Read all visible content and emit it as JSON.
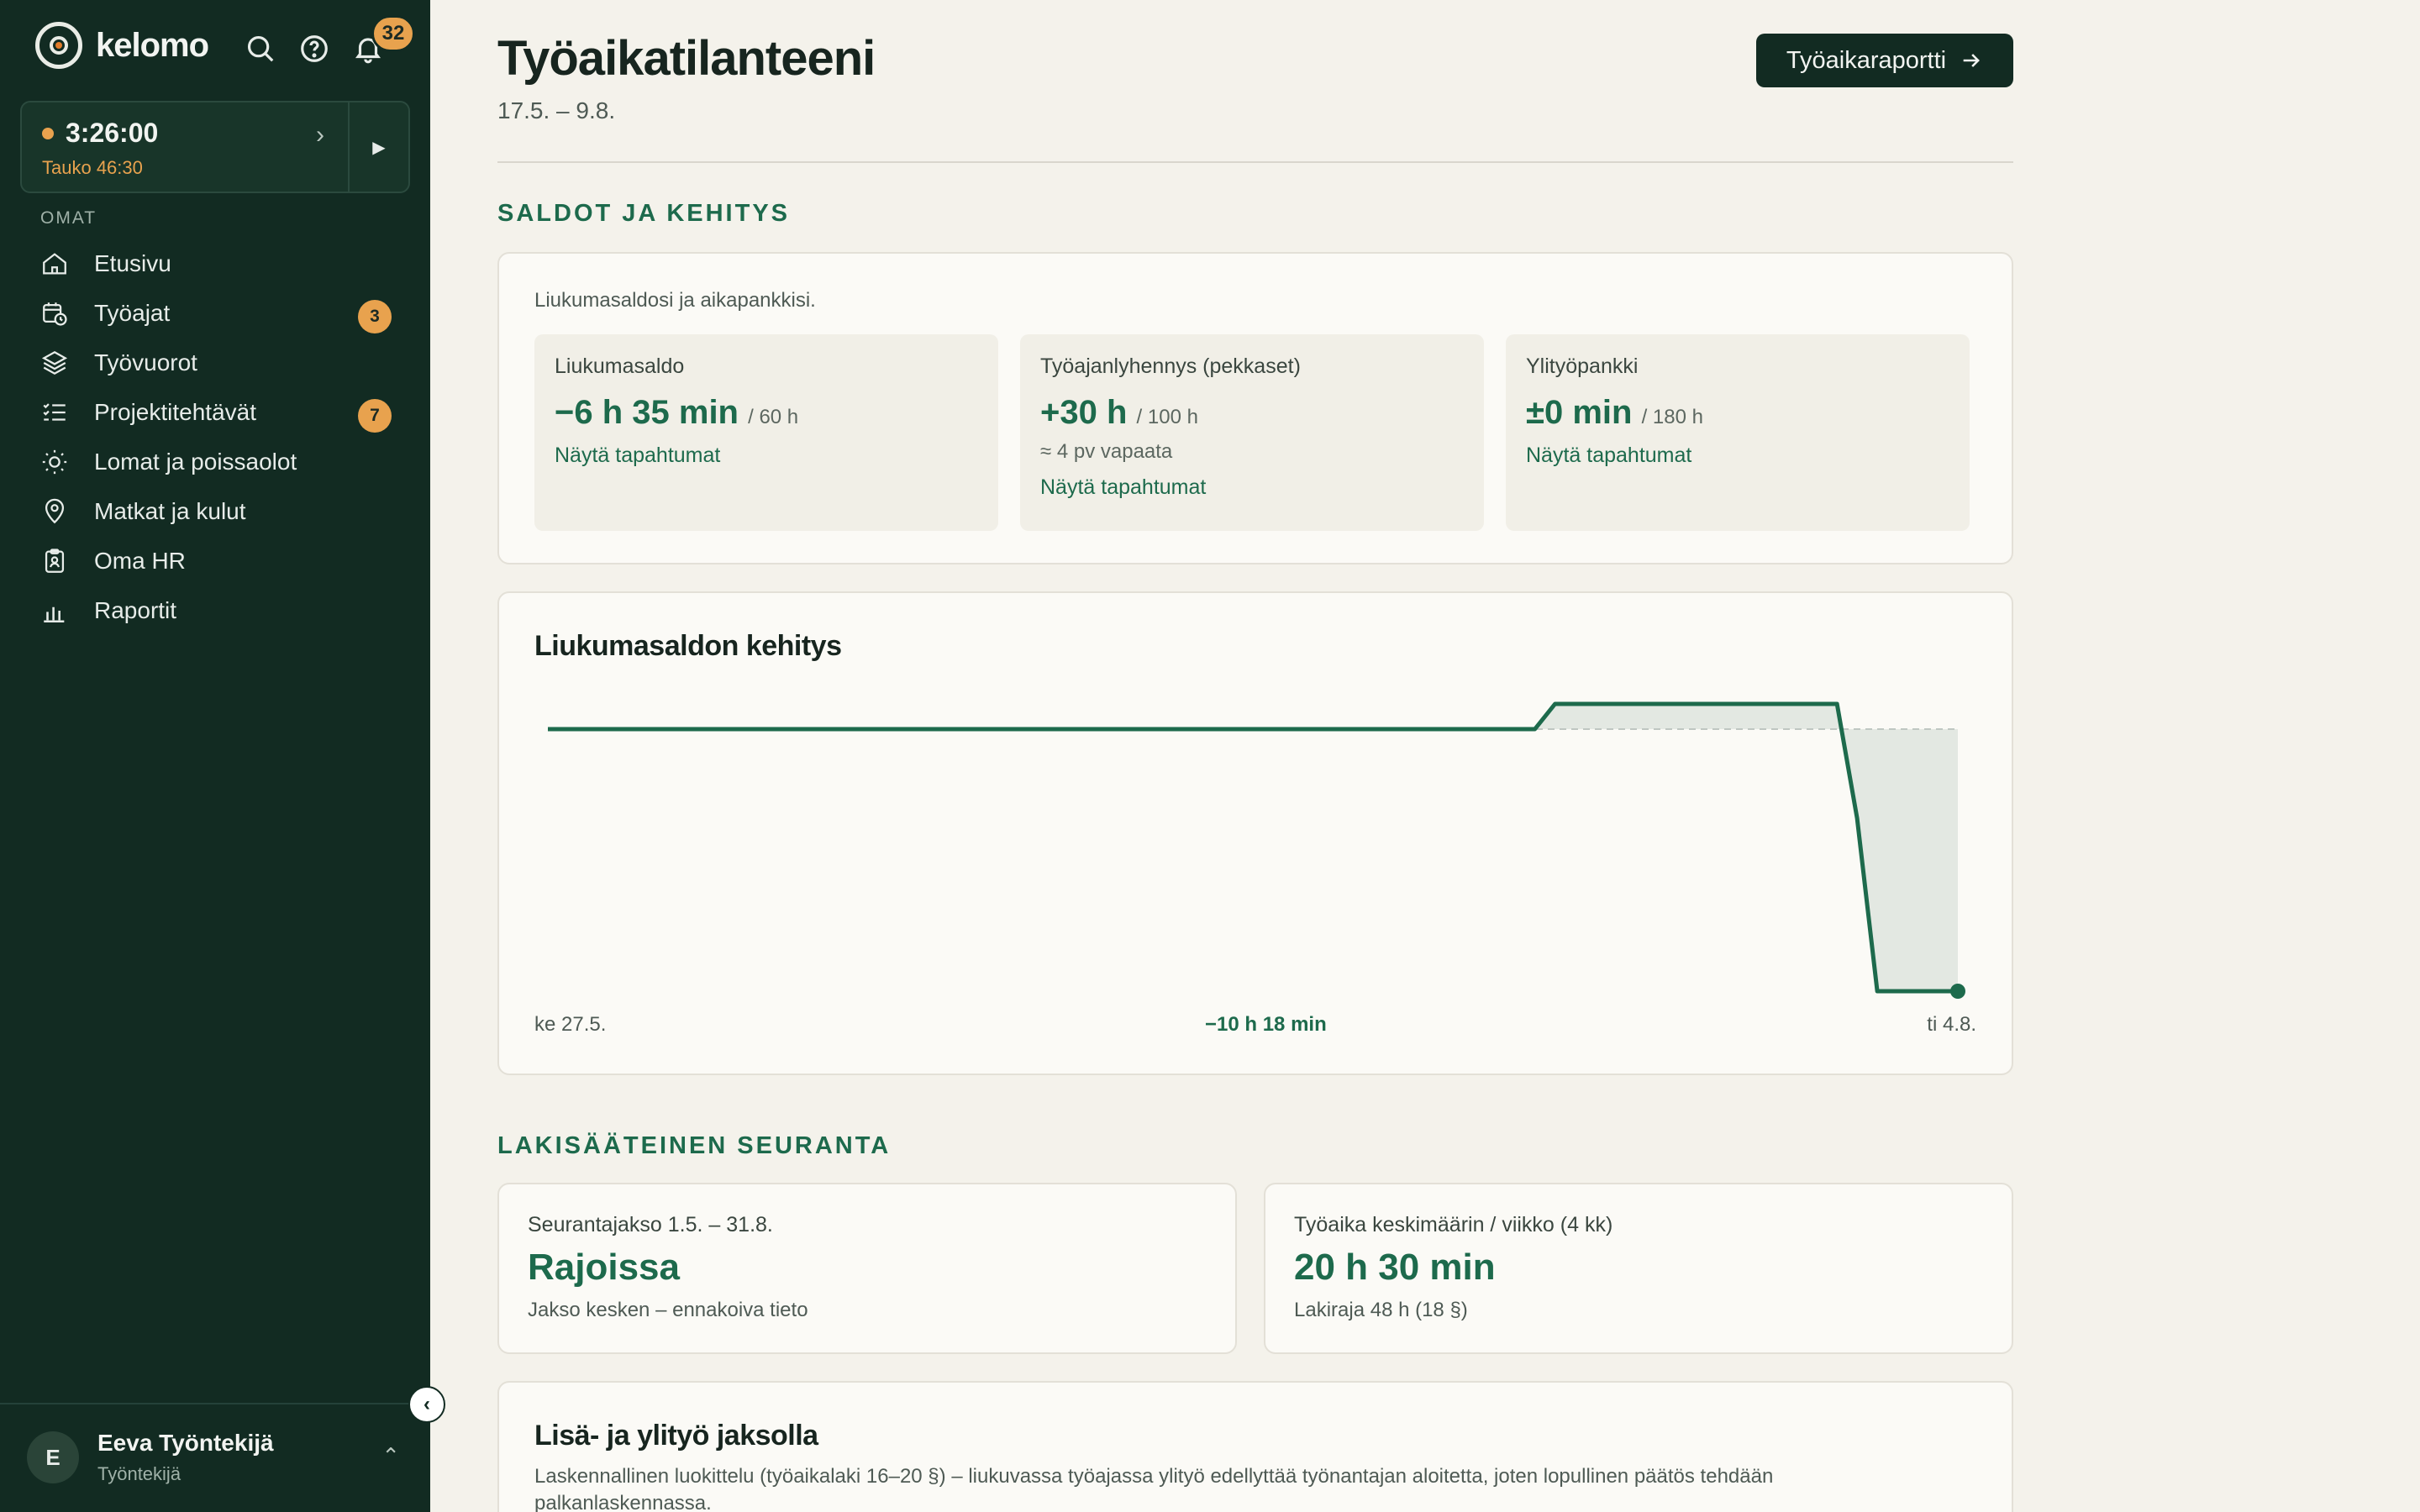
{
  "brand": {
    "name": "kelomo"
  },
  "header_icons": {
    "search": "search-icon",
    "help": "help-icon",
    "bell": "bell-icon",
    "notification_count": "32"
  },
  "timer": {
    "time": "3:26:00",
    "break": "Tauko 46:30"
  },
  "sidebar": {
    "section_label": "OMAT",
    "items": [
      {
        "label": "Etusivu",
        "icon": "home-icon"
      },
      {
        "label": "Työajat",
        "icon": "calendar-clock-icon",
        "badge": "3"
      },
      {
        "label": "Työvuorot",
        "icon": "layers-icon"
      },
      {
        "label": "Projektitehtävät",
        "icon": "checklist-icon",
        "badge": "7"
      },
      {
        "label": "Lomat ja poissaolot",
        "icon": "sun-icon"
      },
      {
        "label": "Matkat ja kulut",
        "icon": "map-pin-icon"
      },
      {
        "label": "Oma HR",
        "icon": "clipboard-user-icon"
      },
      {
        "label": "Raportit",
        "icon": "bar-chart-icon"
      }
    ]
  },
  "user": {
    "initial": "E",
    "name": "Eeva Työntekijä",
    "role": "Työntekijä"
  },
  "page": {
    "title": "Työaikatilanteeni",
    "period": "17.5. – 9.8.",
    "report_button": "Työaikaraportti"
  },
  "balances": {
    "heading": "SALDOT JA KEHITYS",
    "intro": "Liukumasaldosi ja aikapankkisi.",
    "cards": [
      {
        "label": "Liukumasaldo",
        "value": "−6 h 35 min",
        "of": "/ 60 h",
        "extra": "",
        "link": "Näytä tapahtumat"
      },
      {
        "label": "Työajanlyhennys (pekkaset)",
        "value": "+30 h",
        "of": "/ 100 h",
        "extra": "≈ 4 pv vapaata",
        "link": "Näytä tapahtumat"
      },
      {
        "label": "Ylityöpankki",
        "value": "±0 min",
        "of": "/ 180 h",
        "extra": "",
        "link": "Näytä tapahtumat"
      }
    ]
  },
  "chart": {
    "title": "Liukumasaldon kehitys",
    "x_start_label": "ke 27.5.",
    "x_end_label": "ti 4.8.",
    "current_value_label": "−10 h 18 min"
  },
  "chart_data": {
    "type": "line",
    "title": "Liukumasaldon kehitys",
    "x_labels": [
      "ke 27.5.",
      "ti 4.8."
    ],
    "points": [
      0,
      0,
      0,
      0,
      0,
      0,
      0,
      0,
      0,
      0,
      0,
      0,
      0,
      0,
      0,
      0,
      0,
      0,
      0,
      0,
      0,
      0,
      0,
      0,
      0,
      0,
      0,
      0,
      0,
      0,
      0,
      0,
      0,
      0,
      0,
      0,
      0,
      0,
      0,
      0,
      0,
      0,
      0,
      0,
      0,
      0,
      0,
      0,
      0,
      0,
      1,
      1,
      1,
      1,
      1,
      1,
      1,
      1,
      1,
      1,
      1,
      1,
      1,
      1,
      1,
      -3.5,
      -10.3,
      -10.3,
      -10.3,
      -10.3,
      -10.3
    ],
    "baseline": 0,
    "final_value_label": "−10 h 18 min",
    "colors": {
      "line": "#1d6a4c",
      "fill": "#e3e8e2",
      "baseline": "#bfc7c2"
    }
  },
  "legal": {
    "heading": "LAKISÄÄTEINEN SEURANTA",
    "cards": [
      {
        "label": "Seurantajakso 1.5. – 31.8.",
        "value": "Rajoissa",
        "note": "Jakso kesken – ennakoiva tieto"
      },
      {
        "label": "Työaika keskimäärin / viikko (4 kk)",
        "value": "20 h 30 min",
        "note": "Lakiraja 48 h (18 §)"
      }
    ]
  },
  "extra_work": {
    "title": "Lisä- ja ylityö jaksolla",
    "description": "Laskennallinen luokittelu (työaikalaki 16–20 §) – liukuvassa työajassa ylityö edellyttää työnantajan aloitetta, joten lopullinen päätös tehdään palkanlaskennassa."
  },
  "colors": {
    "sidebar_bg": "#122b22",
    "accent_green": "#1d6a4c",
    "badge_orange": "#e8a24e",
    "page_bg": "#f4f2eb"
  }
}
